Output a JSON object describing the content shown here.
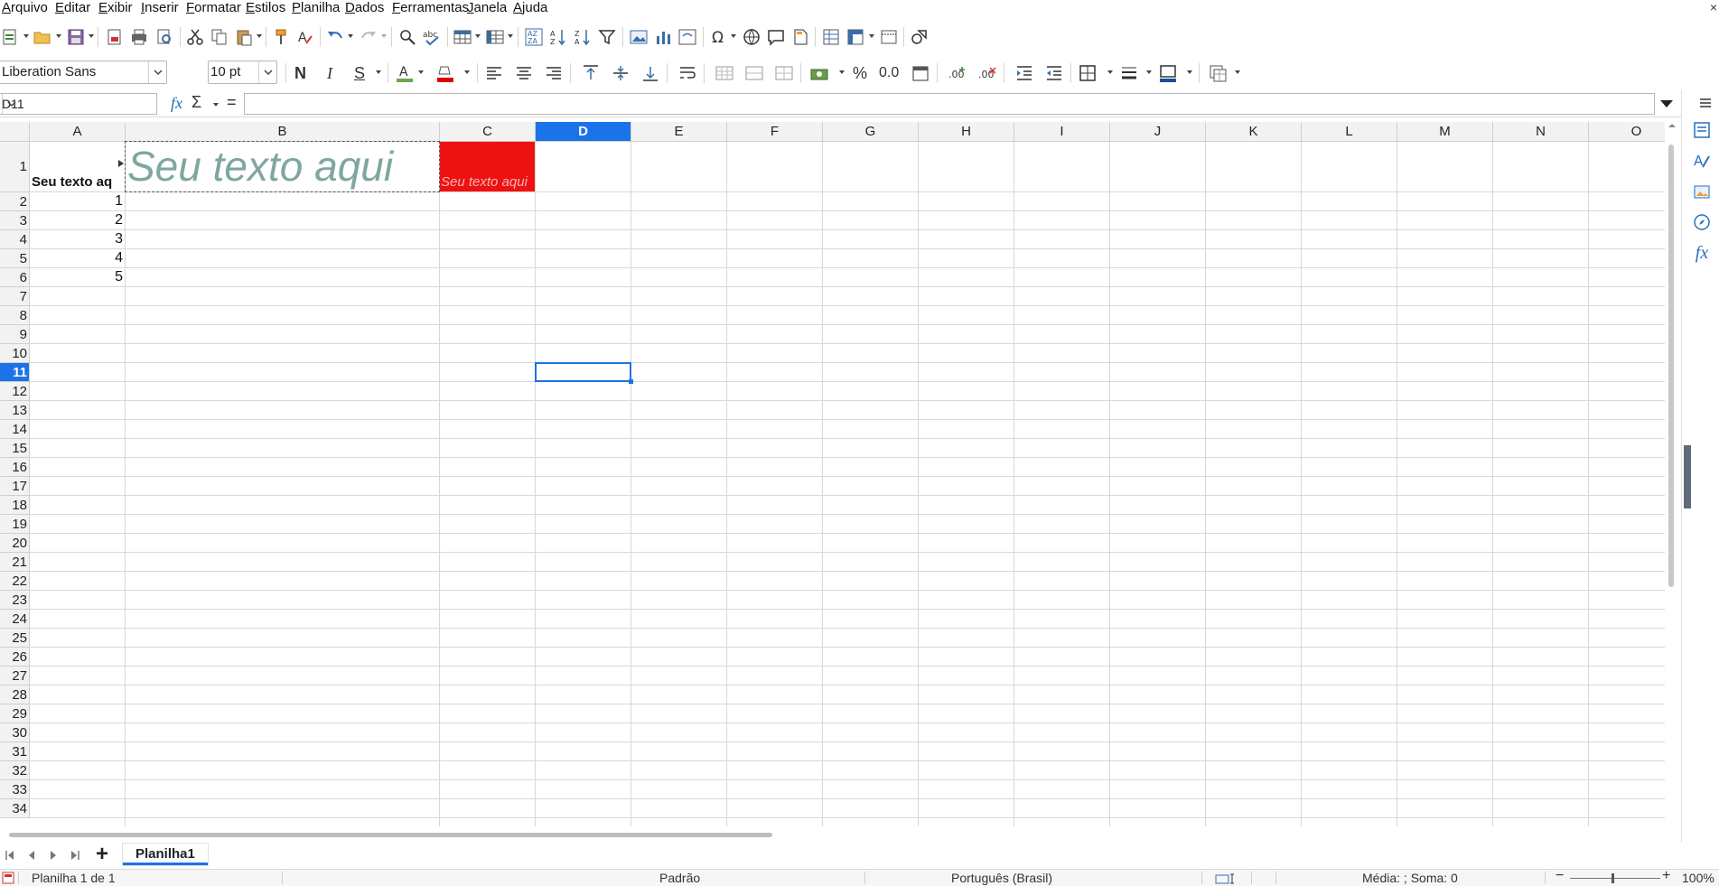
{
  "menu": [
    "Arquivo",
    "Editar",
    "Exibir",
    "Inserir",
    "Formatar",
    "Estilos",
    "Planilha",
    "Dados",
    "Ferramentas",
    "Janela",
    "Ajuda"
  ],
  "close_glyph": "×",
  "toolbar2": {
    "font_name": "Liberation Sans",
    "font_size": "10 pt",
    "bold": "N",
    "italic": "I",
    "underline": "S",
    "percent": "%",
    "decimal": "0.0"
  },
  "formula_bar": {
    "cell_ref": "D11",
    "fx": "fx",
    "sum": "Σ",
    "equals": "=",
    "value": ""
  },
  "columns": [
    "A",
    "B",
    "C",
    "D",
    "E",
    "F",
    "G",
    "H",
    "I",
    "J",
    "K",
    "L",
    "M",
    "N",
    "O"
  ],
  "active_column": "D",
  "rows": [
    "1",
    "2",
    "3",
    "4",
    "5",
    "6",
    "7",
    "8",
    "9",
    "10",
    "11",
    "12",
    "13",
    "14",
    "15",
    "16",
    "17",
    "18",
    "19",
    "20",
    "21",
    "22",
    "23",
    "24",
    "25",
    "26",
    "27",
    "28",
    "29",
    "30",
    "31",
    "32",
    "33",
    "34"
  ],
  "active_row": "11",
  "cells": {
    "A1": "Seu texto aq",
    "B1": "Seu texto aqui",
    "C1": "Seu texto aqui",
    "A2": "1",
    "A3": "2",
    "A4": "3",
    "A5": "4",
    "A6": "5"
  },
  "colors": {
    "accent": "#1a73e8",
    "c1_fill": "#ee1111",
    "b1_text": "#7fa6a0",
    "font_color_bar": "#6aa84f",
    "highlight_bar": "#e00000"
  },
  "sheet_tab": "Planilha1",
  "status": {
    "sheet": "Planilha 1 de 1",
    "style": "Padrão",
    "language": "Português (Brasil)",
    "sum": "Média: ; Soma: 0",
    "zoom": "100%"
  }
}
